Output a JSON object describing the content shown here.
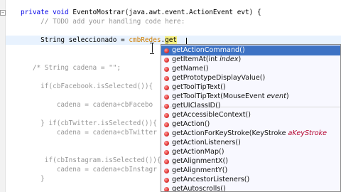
{
  "editor": {
    "lines": [
      {
        "parts": [
          {
            "t": "   "
          },
          {
            "t": "private void ",
            "c": "kw"
          },
          {
            "t": "EventoMostrar",
            "c": "ident"
          },
          {
            "t": "(java.awt.event.ActionEvent "
          },
          {
            "t": "evt"
          },
          {
            "t": ") {"
          }
        ]
      },
      {
        "parts": [
          {
            "t": "        "
          },
          {
            "t": "// TODO add your handling code here:",
            "c": "cm"
          }
        ]
      },
      {
        "parts": []
      },
      {
        "parts": [
          {
            "t": "        String seleccionado = "
          },
          {
            "t": "cmbRedes",
            "c": "str"
          },
          {
            "t": "."
          },
          {
            "t": "get",
            "c": "hl"
          }
        ]
      },
      {
        "parts": []
      },
      {
        "parts": []
      },
      {
        "parts": [
          {
            "t": "      "
          },
          {
            "t": "/* String cadena = \"\";",
            "c": "cm"
          }
        ]
      },
      {
        "parts": []
      },
      {
        "parts": [
          {
            "t": "        "
          },
          {
            "t": "if(cbFacebook.isSelected()){",
            "c": "cm"
          }
        ]
      },
      {
        "parts": []
      },
      {
        "parts": [
          {
            "t": "            "
          },
          {
            "t": "cadena = cadena+cbFacebo",
            "c": "cm"
          }
        ]
      },
      {
        "parts": []
      },
      {
        "parts": [
          {
            "t": "        "
          },
          {
            "t": "} if(cbTwitter.isSelected()){",
            "c": "cm"
          }
        ]
      },
      {
        "parts": [
          {
            "t": "            "
          },
          {
            "t": "cadena = cadena+cbTwitter",
            "c": "cm"
          }
        ]
      },
      {
        "parts": []
      },
      {
        "parts": []
      },
      {
        "parts": [
          {
            "t": "        "
          },
          {
            "t": " if(cbInstagram.isSelected()){",
            "c": "cm"
          }
        ]
      },
      {
        "parts": [
          {
            "t": "            "
          },
          {
            "t": "cadena = cadena+cbInstagr",
            "c": "cm"
          }
        ]
      },
      {
        "parts": [
          {
            "t": "        "
          },
          {
            "t": "}",
            "c": "cm"
          }
        ]
      },
      {
        "parts": []
      }
    ]
  },
  "completion": {
    "items": [
      {
        "name": "getActionCommand",
        "params": "()",
        "selected": true
      },
      {
        "name": "getItemAt",
        "params": "(int ",
        "param_name": "index",
        "tail": ")"
      },
      {
        "name": "getName",
        "params": "()"
      },
      {
        "name": "getPrototypeDisplayValue",
        "params": "()"
      },
      {
        "name": "getToolTipText",
        "params": "()"
      },
      {
        "name": "getToolTipText",
        "params": "(MouseEvent ",
        "param_name": "event",
        "tail": ")"
      },
      {
        "name": "getUIClassID",
        "params": "()"
      },
      {
        "name": "getAccessibleContext",
        "params": "()"
      },
      {
        "name": "getAction",
        "params": "()"
      },
      {
        "name": "getActionForKeyStroke",
        "params": "(KeyStroke ",
        "param_name": "aKeyStroke",
        "tail": ""
      },
      {
        "name": "getActionListeners",
        "params": "()"
      },
      {
        "name": "getActionMap",
        "params": "()"
      },
      {
        "name": "getAlignmentX",
        "params": "()"
      },
      {
        "name": "getAlignmentY",
        "params": "()"
      },
      {
        "name": "getAncestorListeners",
        "params": "()"
      },
      {
        "name": "getAutoscrolls",
        "params": "()"
      }
    ]
  },
  "colors": {
    "keyword": "#0000e6",
    "comment": "#969696",
    "field": "#ce7b00",
    "selection": "#3d72c4",
    "current_line": "#e8f2fe"
  },
  "icons": {
    "method": "method-bullet-icon",
    "fold": "fold-toggle-icon"
  }
}
